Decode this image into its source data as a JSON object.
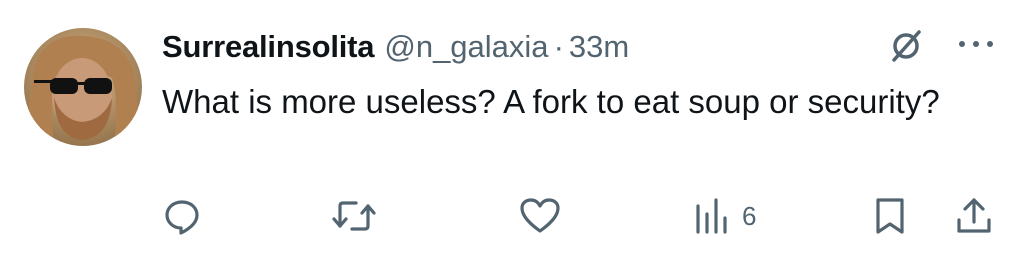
{
  "tweet": {
    "author": {
      "display_name": "Surrealinsolita",
      "handle": "@n_galaxia",
      "avatar_icon": "avatar"
    },
    "separator": "·",
    "time": "33m",
    "text": "What is more useless? A fork to eat soup or security?",
    "header_icons": [
      "grok-icon",
      "more-icon"
    ]
  },
  "actions": {
    "reply": {
      "icon": "reply-icon"
    },
    "retweet": {
      "icon": "retweet-icon"
    },
    "like": {
      "icon": "heart-icon"
    },
    "views": {
      "icon": "views-icon",
      "count": "6"
    },
    "bookmark": {
      "icon": "bookmark-icon"
    },
    "share": {
      "icon": "share-icon"
    }
  },
  "colors": {
    "text": "#0f1419",
    "secondary": "#536471",
    "background": "#ffffff"
  }
}
